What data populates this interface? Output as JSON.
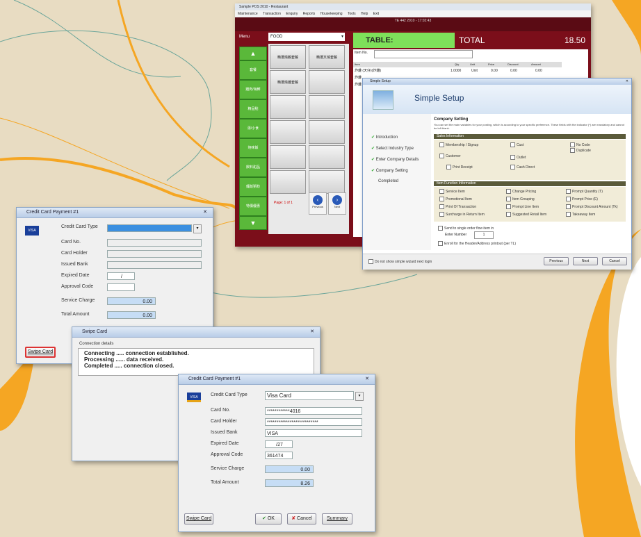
{
  "pos": {
    "title": "Sample POS 2010 - Restaurant",
    "menu": [
      "Maintenance",
      "Transaction",
      "Enquiry",
      "Reports",
      "Housekeeping",
      "Tools",
      "Help",
      "Exit"
    ],
    "header_text": "TE 442 2010 - 17:02:43",
    "category_label": "Menu",
    "category_value": "FOOD",
    "table_label": "TABLE:",
    "total_label": "TOTAL",
    "total_value": "18.50",
    "item_no_label": "Item No.",
    "columns": [
      "Item",
      "Qty",
      "Unit",
      "Price",
      "Discount",
      "Amount"
    ],
    "order_rows": [
      [
        "炸雞 (天仔)(炸雞)",
        "1.0000",
        "Unit",
        "0.00",
        "0.00",
        "0.00"
      ],
      [
        "炸雞",
        " ",
        "",
        "",
        "",
        ""
      ],
      [
        "炸雞",
        " ",
        "",
        "",
        "",
        ""
      ]
    ],
    "up_arrow": "▲",
    "down_arrow": "▼",
    "category_buttons": [
      "套餐",
      "雞肉/海鮮",
      "精品點",
      "湯/小食",
      "燒味飯",
      "飲料甜品",
      "麵飯粥粉",
      "特價優惠"
    ],
    "grid_items": [
      "精選燒鵝套餐",
      "精選叉燒套餐",
      "精選燒雞套餐",
      "",
      "",
      "",
      "",
      "",
      "",
      "",
      "",
      "",
      "",
      ""
    ],
    "page_text": "Page: 1 of 1",
    "prev_label": "Previous",
    "next_label": "Next"
  },
  "setup": {
    "window_title": "Simple Setup",
    "heading": "Simple Setup",
    "steps": [
      "Introduction",
      "Select Industry Type",
      "Enter Company Details",
      "Company Setting",
      "Completed"
    ],
    "section_title": "Company Setting",
    "description": "You can set the main variables for your posting, which is according to your specific preference. These fields with the indicator (*) are mandatory and cannot be left blank.",
    "group1": "Sales Information",
    "group1_items": [
      "Membership / Signup",
      "Cust",
      "No Code",
      "Customer",
      "",
      "Duplicate",
      "Outlet",
      "Cash Direct",
      "Print Receipt"
    ],
    "group2": "Item Function Information",
    "group2_items": [
      "Service Item",
      "Change Pricing",
      "Prompt Quantity (T)",
      "Promotional Item",
      "Item Grouping",
      "Prompt Price (E)",
      "Print Of Transaction",
      "Prompt Line Item",
      "Prompt Discount Amount (Tk)",
      "Surcharge in Return Item",
      "Suggested Retail Item",
      "Takeaway Item"
    ],
    "option1": "Send to single order flow item in",
    "option1_sub": "Enter Number",
    "option1_val": "1",
    "option2": "Enroll for the Header/Address printout (per TL)",
    "footer_check": "Do not show simple wizard next login",
    "btn_prev": "Previous",
    "btn_next": "Next",
    "btn_cancel": "Cancel"
  },
  "cc1": {
    "title": "Credit Card Payment #1",
    "type_label": "Credit Card Type",
    "type_value": "",
    "cardno_label": "Card No.",
    "holder_label": "Card Holder",
    "bank_label": "Issued Bank",
    "expiry_label": "Expired Date",
    "expiry_value": "/",
    "approval_label": "Approval Code",
    "service_label": "Service Charge",
    "service_value": "0.00",
    "total_label": "Total Amount",
    "total_value": "0.00",
    "swipe_label": "Swipe Card"
  },
  "swipe": {
    "title": "Swipe Card",
    "status_label": "Connection details",
    "log": [
      "Connecting ..... connection established.",
      "Processing ...... data received.",
      "Completed ..... connection closed."
    ]
  },
  "cc2": {
    "title": "Credit Card Payment #1",
    "type_label": "Credit Card Type",
    "type_value": "Visa Card",
    "cardno_label": "Card No.",
    "cardno_value": "************4016",
    "holder_label": "Card Holder",
    "holder_value": "***************************",
    "bank_label": "Issued Bank",
    "bank_value": "VISA",
    "expiry_label": "Expired Date",
    "expiry_value": "/27",
    "approval_label": "Approval Code",
    "approval_value": "361474",
    "service_label": "Service Charge",
    "service_value": "0.00",
    "total_label": "Total Amount",
    "total_value": "8.26",
    "swipe_label": "Swipe Card",
    "ok_label": "OK",
    "cancel_label": "Cancel",
    "summary_label": "Summary"
  },
  "colors": {
    "accent_orange": "#f5a623",
    "pos_red": "#7b0e1a",
    "pos_green": "#5ab83a",
    "background": "#e8dcc2"
  }
}
